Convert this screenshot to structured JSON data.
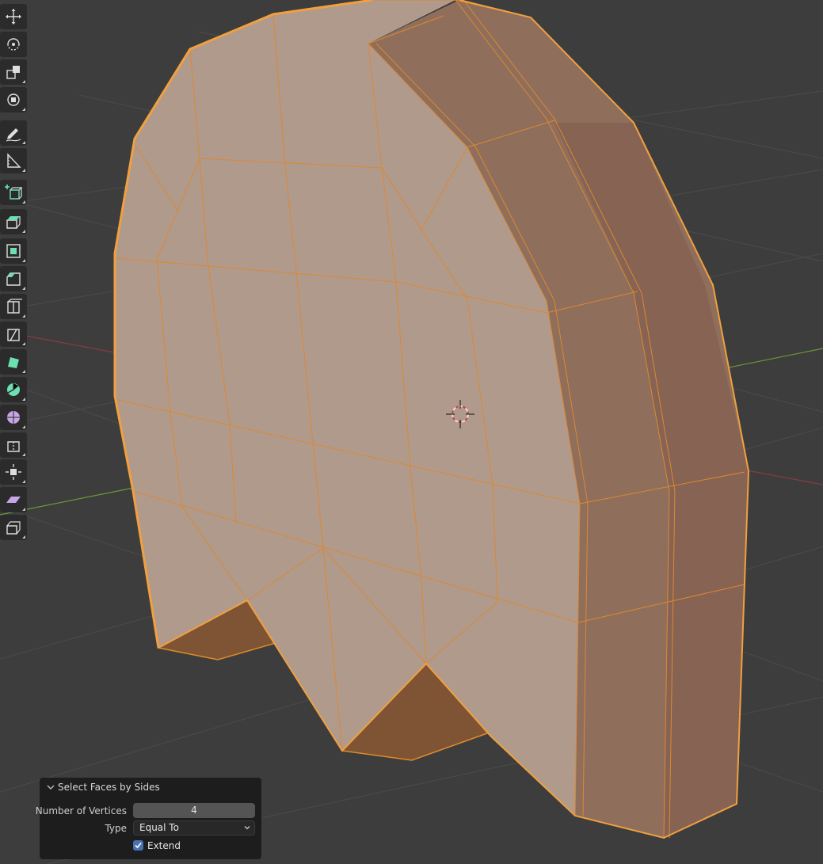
{
  "viewport": {
    "colors": {
      "background": "#3d3d3d",
      "grid": "#4a4a4a",
      "x_axis": "#8a3a44",
      "y_axis": "#6a9a3a",
      "face_fill": "#b09a8c",
      "face_side": "#8a6a58",
      "face_underside": "#7e5434",
      "edge_selected": "#e08a2a",
      "outline": "#f0a040"
    }
  },
  "toolbar": {
    "tools": [
      {
        "icon": "move-icon"
      },
      {
        "icon": "rotate-icon"
      },
      {
        "icon": "scale-icon"
      },
      {
        "icon": "transform-icon"
      },
      {
        "icon": "annotate-icon"
      },
      {
        "icon": "measure-icon"
      },
      {
        "icon": "add-cube-icon"
      },
      {
        "icon": "extrude-region-icon"
      },
      {
        "icon": "inset-faces-icon"
      },
      {
        "icon": "bevel-icon"
      },
      {
        "icon": "loop-cut-icon"
      },
      {
        "icon": "knife-icon"
      },
      {
        "icon": "poly-build-icon"
      },
      {
        "icon": "spin-icon"
      },
      {
        "icon": "smooth-icon"
      },
      {
        "icon": "edge-slide-icon"
      },
      {
        "icon": "shrink-fatten-icon"
      },
      {
        "icon": "shear-icon"
      },
      {
        "icon": "rip-region-icon"
      }
    ]
  },
  "operator_panel": {
    "title": "Select Faces by Sides",
    "number_of_vertices_label": "Number of Vertices",
    "number_of_vertices_value": "4",
    "type_label": "Type",
    "type_value": "Equal To",
    "extend_label": "Extend",
    "extend_checked": true
  }
}
